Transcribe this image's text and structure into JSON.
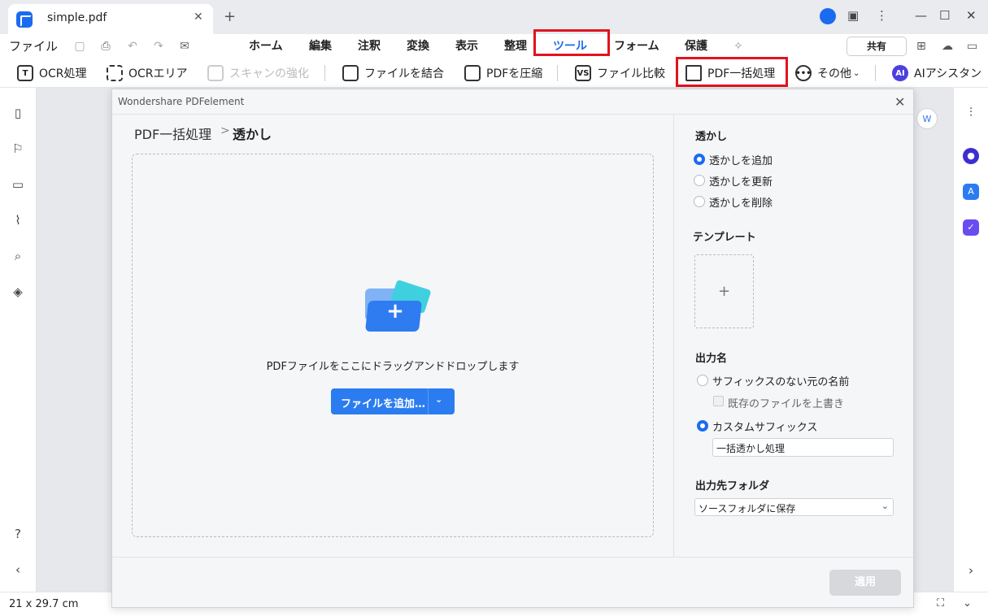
{
  "titlebar": {
    "tab_title": "simple.pdf",
    "tab_close": "✕",
    "new_tab": "+"
  },
  "menubar": {
    "file": "ファイル",
    "tabs": [
      "ホーム",
      "編集",
      "注釈",
      "変換",
      "表示",
      "整理",
      "ツール",
      "フォーム",
      "保護"
    ],
    "active_tab": "ツール",
    "share": "共有"
  },
  "toolbar": {
    "ocr": "OCR処理",
    "ocr_area": "OCRエリア",
    "scan_enhance": "スキャンの強化",
    "combine": "ファイルを結合",
    "compress": "PDFを圧縮",
    "compare": "ファイル比較",
    "batch": "PDF一括処理",
    "more": "その他",
    "ai": "AIアシスタン",
    "ai_badge": "AI"
  },
  "dialog": {
    "title": "Wondershare PDFelement",
    "breadcrumb_root": "PDF一括処理",
    "breadcrumb_sep": ">",
    "breadcrumb_current": "透かし",
    "drop_text": "PDFファイルをここにドラッグアンドドロップします",
    "add_files": "ファイルを追加…",
    "watermark": {
      "section": "透かし",
      "options": [
        "透かしを追加",
        "透かしを更新",
        "透かしを削除"
      ],
      "selected": "透かしを追加"
    },
    "template": {
      "section": "テンプレート",
      "add": "+"
    },
    "output_name": {
      "section": "出力名",
      "option_original": "サフィックスのない元の名前",
      "overwrite": "既存のファイルを上書き",
      "option_custom": "カスタムサフィックス",
      "suffix_value": "一括透かし処理"
    },
    "output_folder": {
      "section": "出力先フォルダ",
      "value": "ソースフォルダに保存"
    },
    "apply": "適用"
  },
  "status": {
    "page_size": "21 x 29.7 cm"
  },
  "colors": {
    "accent": "#1a6bf0",
    "highlight_box": "#e0141e"
  }
}
